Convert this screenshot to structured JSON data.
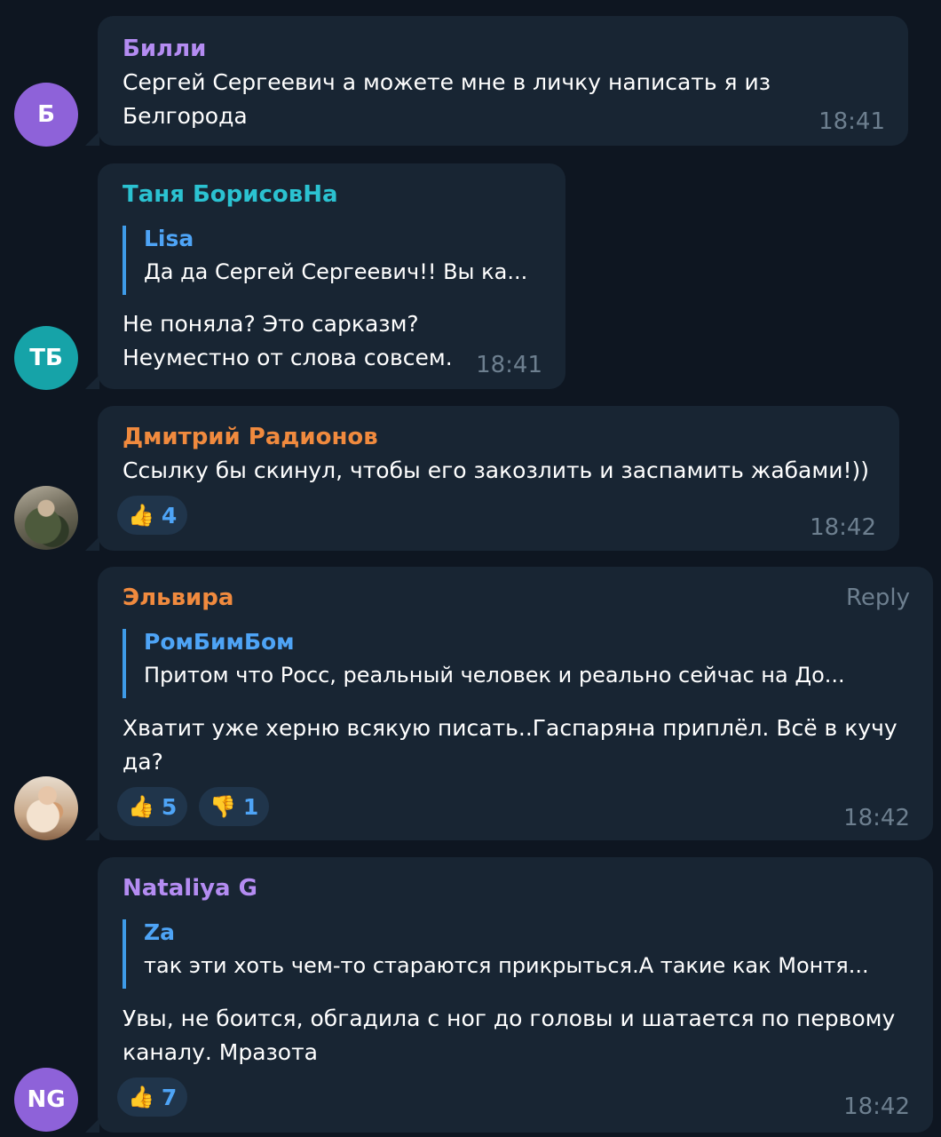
{
  "messages": [
    {
      "author": "Билли",
      "author_color": "#b48cf2",
      "avatar_initials": "Б",
      "avatar_color": "#8e62d9",
      "lines": [
        "Сергей Сергеевич а можете мне в личку написать я из",
        "Белгорода"
      ],
      "time": "18:41"
    },
    {
      "author": "Таня БорисовНа",
      "author_color": "#2bc2d1",
      "avatar_initials": "ТБ",
      "avatar_color": "#16a3a8",
      "quote": {
        "author": "Lisa",
        "text": "Да да Сергей Сергеевич!! Вы ка..."
      },
      "lines": [
        "Не поняла? Это сарказм?",
        "Неуместно от слова совсем."
      ],
      "time": "18:41"
    },
    {
      "author": "Дмитрий Радионов",
      "author_color": "#f08a3e",
      "avatar_icon": "user-photo",
      "lines": [
        "Ссылку бы скинул, чтобы его закозлить и заспамить жабами!))"
      ],
      "reactions": [
        {
          "emoji": "👍",
          "icon": "thumbs-up-icon",
          "count": "4"
        }
      ],
      "time": "18:42"
    },
    {
      "author": "Эльвира",
      "author_color": "#f08a3e",
      "reply_label": "Reply",
      "avatar_icon": "user-photo",
      "quote": {
        "author": "РомБимБом",
        "text": "Притом что Росс, реальный человек и реально сейчас на До..."
      },
      "lines": [
        "Хватит уже херню всякую писать..Гаспаряна приплёл. Всё в кучу",
        "да?"
      ],
      "reactions": [
        {
          "emoji": "👍",
          "icon": "thumbs-up-icon",
          "count": "5"
        },
        {
          "emoji": "👎",
          "icon": "thumbs-down-icon",
          "count": "1"
        }
      ],
      "time": "18:42"
    },
    {
      "author": "Nataliya G",
      "author_color": "#b48cf2",
      "avatar_initials": "NG",
      "avatar_color": "#8e62d9",
      "quote": {
        "author": "Za",
        "text": "так эти хоть чем-то стараются прикрыться.А такие как Монтя..."
      },
      "lines": [
        "Увы, не боится, обгадила с ног до головы и шатается по первому",
        "каналу. Мразота"
      ],
      "reactions": [
        {
          "emoji": "👍",
          "icon": "thumbs-up-icon",
          "count": "7"
        }
      ],
      "time": "18:42"
    }
  ]
}
